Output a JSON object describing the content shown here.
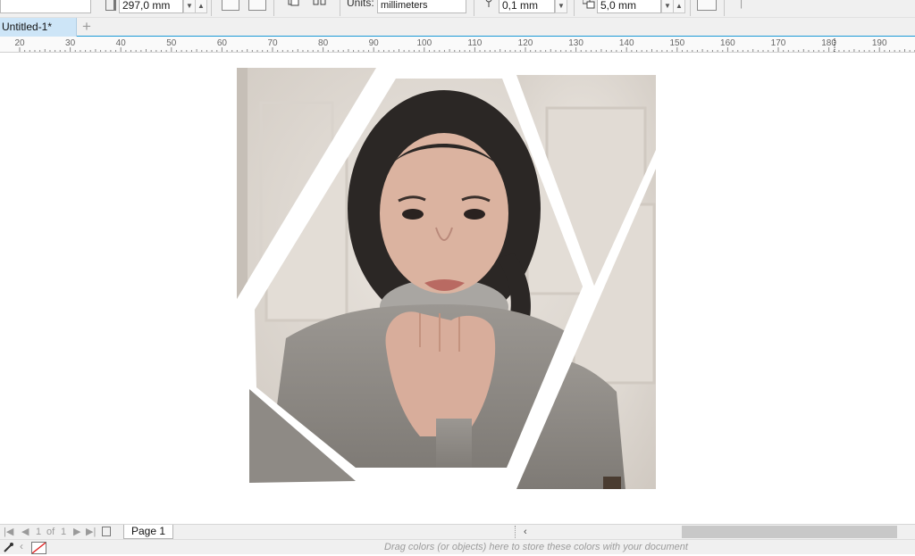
{
  "property_bar": {
    "page_height_value": "297,0 mm",
    "units_label": "Units:",
    "units_value": "millimeters",
    "nudge_value": "0,1 mm",
    "duplicate_distance_value": "5,0 mm"
  },
  "tabs": {
    "document_tab": "Untitled-1*",
    "add_tab_symbol": "+"
  },
  "ruler": {
    "labels": [
      "20",
      "30",
      "40",
      "50",
      "60",
      "70",
      "80",
      "90",
      "100",
      "110",
      "120",
      "130",
      "140",
      "150",
      "160",
      "170",
      "180",
      "190"
    ]
  },
  "page_navigation": {
    "current_page": "1",
    "of_label": "of",
    "total_pages": "1",
    "page_tab_label": "Page 1"
  },
  "status": {
    "drop_hint": "Drag colors (or objects) here to store these colors with your document"
  },
  "colors": {
    "accent": "#1b9ad6",
    "tab_active": "#cde5f7",
    "chrome": "#f0f0f0"
  }
}
